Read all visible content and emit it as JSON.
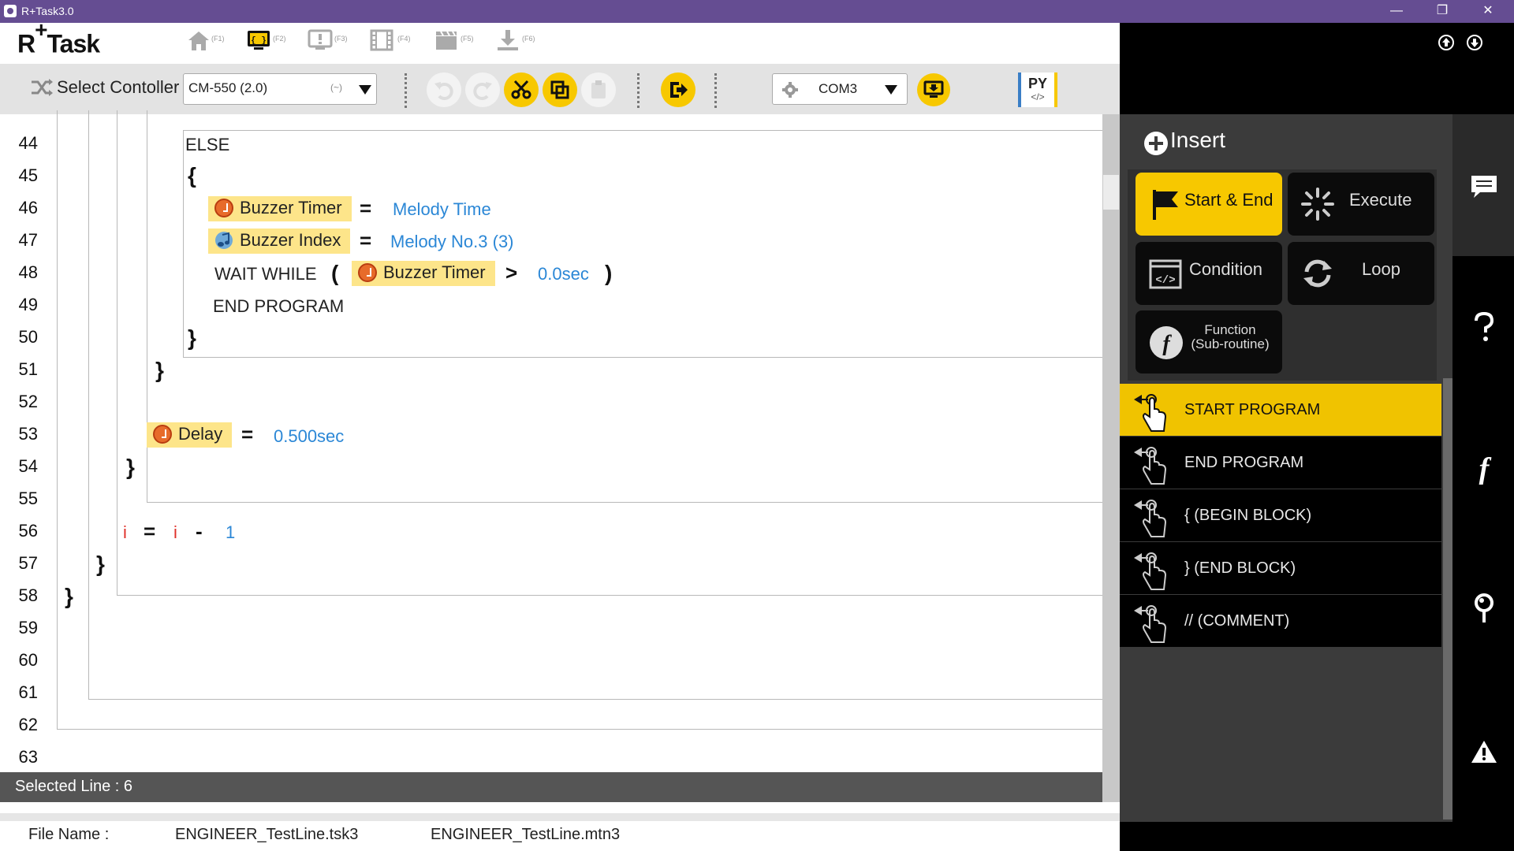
{
  "window": {
    "title": "R+Task3.0",
    "minimize": "—",
    "restore": "❐",
    "close": "✕"
  },
  "header": {
    "logo": "R",
    "logo_plus": "+",
    "logo_task": "Task",
    "nav": [
      {
        "icon": "home-icon",
        "fkey": "(F1)"
      },
      {
        "icon": "task-code-icon",
        "fkey": "(F2)"
      },
      {
        "icon": "monitor-icon",
        "fkey": "(F3)"
      },
      {
        "icon": "motion-film-icon",
        "fkey": "(F4)"
      },
      {
        "icon": "clapper-icon",
        "fkey": "(F5)"
      },
      {
        "icon": "download-icon",
        "fkey": "(F6)"
      }
    ]
  },
  "toolbar": {
    "select_controller_label": "Select Contoller",
    "controller_value": "CM-550 (2.0)",
    "controller_hint": "(~)",
    "port_value": "COM3",
    "py_label": "PY",
    "py_sub": "</>"
  },
  "editor": {
    "line_numbers": [
      "44",
      "45",
      "46",
      "47",
      "48",
      "49",
      "50",
      "51",
      "52",
      "53",
      "54",
      "55",
      "56",
      "57",
      "58",
      "59",
      "60",
      "61",
      "62",
      "63"
    ],
    "else_kw": "ELSE",
    "open_brace": "{",
    "close_brace": "}",
    "eq": "=",
    "gt": ">",
    "minus": "-",
    "lparen": "(",
    "rparen": ")",
    "buzzer_timer": "Buzzer Timer",
    "melody_time": "Melody Time",
    "buzzer_index": "Buzzer Index",
    "melody_no": "Melody No.3 (3)",
    "wait_while": "WAIT WHILE",
    "zero_sec": "0.0sec",
    "end_program": "END PROGRAM",
    "delay": "Delay",
    "delay_value": "0.500sec",
    "var_i": "i",
    "one": "1"
  },
  "status": {
    "selected_line": "Selected Line : 6"
  },
  "filebar": {
    "label": "File Name :",
    "task_file": "ENGINEER_TestLine.tsk3",
    "motion_file": "ENGINEER_TestLine.mtn3"
  },
  "insert": {
    "title": "Insert",
    "categories": [
      {
        "label": "Start & End",
        "active": true
      },
      {
        "label": "Execute",
        "active": false
      },
      {
        "label": "Condition",
        "active": false
      },
      {
        "label": "Loop",
        "active": false
      },
      {
        "label": "Function\n(Sub-routine)",
        "active": false
      }
    ],
    "function_line1": "Function",
    "function_line2": "(Sub-routine)",
    "commands": [
      {
        "label": "START PROGRAM",
        "active": true
      },
      {
        "label": "END PROGRAM",
        "active": false
      },
      {
        "label": "{  (BEGIN BLOCK)",
        "active": false
      },
      {
        "label": "}  (END BLOCK)",
        "active": false
      },
      {
        "label": "//  (COMMENT)",
        "active": false
      }
    ]
  },
  "colors": {
    "accent": "#f7c800",
    "title_bar": "#654d92",
    "value_blue": "#2b87d6",
    "var_red": "#e0302a"
  }
}
